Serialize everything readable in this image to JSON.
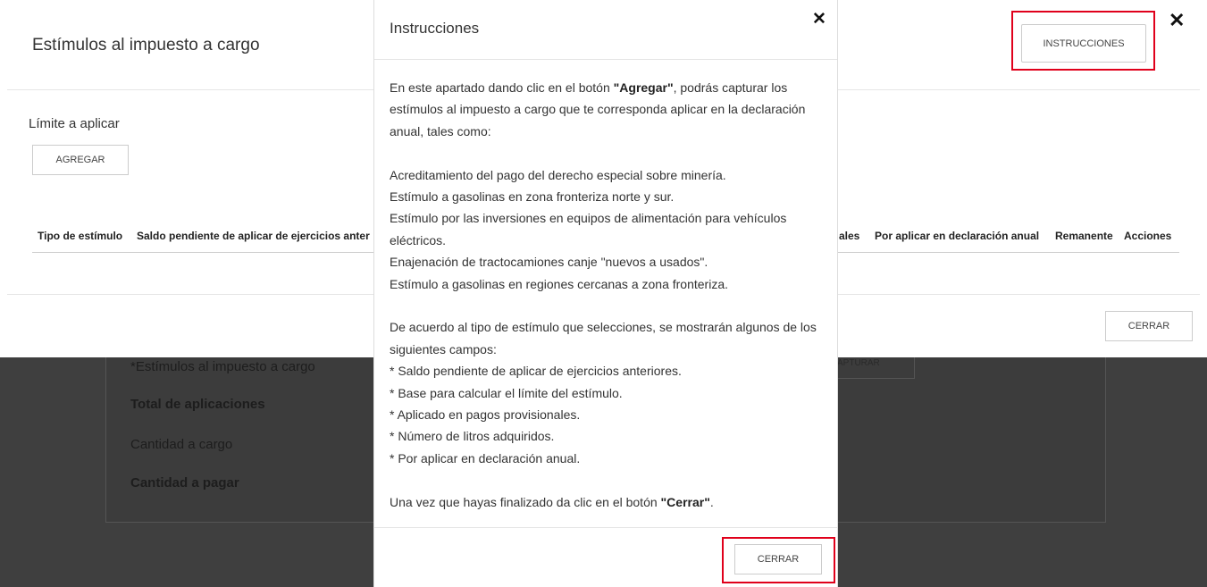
{
  "background": {
    "rows": [
      "*Estímulos al impuesto a cargo",
      "Total de aplicaciones",
      "Cantidad a cargo",
      "Cantidad a pagar"
    ],
    "capturar_label": "APTURAR"
  },
  "modal": {
    "title": "Estímulos al impuesto a cargo",
    "instrucciones_label": "INSTRUCCIONES",
    "limit_label": "Límite a aplicar",
    "agregar_label": "AGREGAR",
    "table_headers": {
      "tipo": "Tipo de estímulo",
      "saldo": "Saldo pendiente de aplicar de ejercicios anter",
      "ales": "ales",
      "por_aplicar": "Por aplicar en declaración anual",
      "remanente": "Remanente",
      "acciones": "Acciones"
    },
    "cerrar_label": "CERRAR"
  },
  "instructions": {
    "title": "Instrucciones",
    "p1_pre": "En este apartado dando clic en el botón ",
    "p1_bold": "\"Agregar\"",
    "p1_post": ", podrás capturar los estímulos al impuesto a cargo que te corresponda aplicar en la declaración anual, tales como:",
    "list1": [
      "Acreditamiento del pago del derecho especial sobre minería.",
      "Estímulo a gasolinas en zona fronteriza norte y sur.",
      "Estímulo por las inversiones en equipos de alimentación para vehículos eléctricos.",
      "Enajenación de tractocamiones canje \"nuevos a usados\".",
      "Estímulo a gasolinas en regiones cercanas a zona fronteriza."
    ],
    "p2": "De acuerdo al tipo de estímulo que selecciones, se mostrarán algunos de los siguientes campos:",
    "list2": [
      "* Saldo pendiente de aplicar de ejercicios anteriores.",
      "* Base para calcular el límite del estímulo.",
      "* Aplicado en pagos provisionales.",
      "* Número de litros adquiridos.",
      "* Por aplicar en declaración anual."
    ],
    "p3_pre": "Una vez que hayas finalizado da clic en el botón ",
    "p3_bold": "\"Cerrar\"",
    "p3_post": ".",
    "cerrar_label": "CERRAR"
  }
}
